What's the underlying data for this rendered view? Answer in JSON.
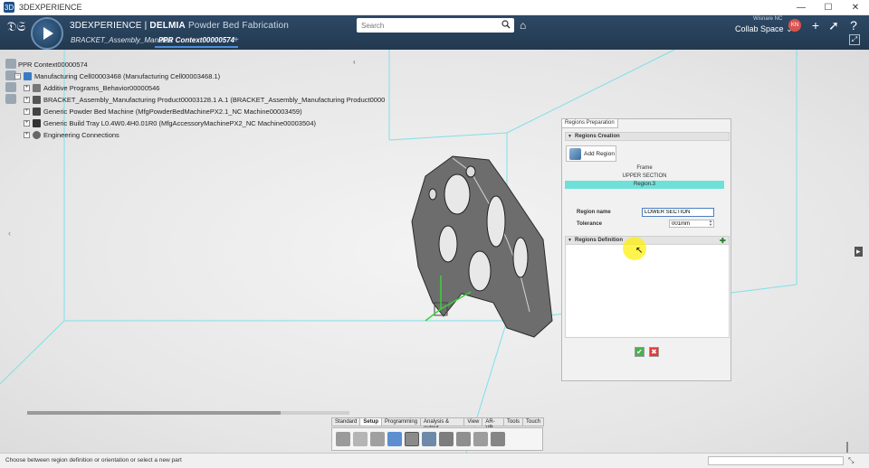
{
  "window": {
    "title": "3DEXPERIENCE",
    "controls": [
      "—",
      "☐",
      "✕"
    ]
  },
  "appbar": {
    "brand": "3DEXPERIENCE",
    "separator": " | ",
    "product": "DELMIA",
    "app": "Powder Bed Fabrication",
    "search_placeholder": "Search",
    "user_name": "Wisnare NC",
    "avatar_initials": "KN",
    "collab_space": "Collab Space"
  },
  "tabs": [
    {
      "label": "BRACKET_Assembly_Manufac",
      "active": false
    },
    {
      "label": "PPR Context00000574",
      "active": true
    }
  ],
  "tree": {
    "root": "PPR Context00000574",
    "items": [
      {
        "label": "Manufacturing Cell00003468 (Manufacturing Cell00003468.1)",
        "level": 1,
        "expander": "−",
        "icon": "manufacturing-cell-icon",
        "color": "#3a7cc4"
      },
      {
        "label": "Additive Programs_Behavior00000546",
        "level": 2,
        "expander": "+",
        "icon": "program-icon",
        "color": "#777777"
      },
      {
        "label": "BRACKET_Assembly_Manufacturing Product00003128.1 A.1 (BRACKET_Assembly_Manufacturing Product0000",
        "level": 2,
        "expander": "+",
        "icon": "product-icon",
        "color": "#555555"
      },
      {
        "label": "Generic Powder Bed Machine (MfgPowderBedMachinePX2.1_NC Machine00003459)",
        "level": 2,
        "expander": "+",
        "icon": "machine-icon",
        "color": "#444444"
      },
      {
        "label": "Generic Build Tray L0.4W0.4H0.01R0 (MfgAccessoryMachinePX2_NC Machine00003504)",
        "level": 2,
        "expander": "+",
        "icon": "tray-icon",
        "color": "#333333"
      },
      {
        "label": "Engineering Connections",
        "level": 2,
        "expander": "+",
        "icon": "connections-icon",
        "color": "#666666"
      }
    ]
  },
  "panel": {
    "tab_label": "Regions Preparation",
    "creation_header": "Regions Creation",
    "add_region_label": "Add Region",
    "regions": [
      {
        "label": "Frame",
        "selected": false
      },
      {
        "label": "UPPER SECTION",
        "selected": false
      },
      {
        "label": "Region.3",
        "selected": true
      }
    ],
    "region_name_label": "Region name",
    "region_name_value": "LOWER SECTION",
    "tolerance_label": "Tolerance",
    "tolerance_value": "001mm",
    "definition_header": "Regions Definition",
    "ok_label": "✔",
    "cancel_label": "✖"
  },
  "action_bar": {
    "tabs": [
      {
        "label": "Standard",
        "active": false
      },
      {
        "label": "Setup",
        "active": true
      },
      {
        "label": "Programming",
        "active": false
      },
      {
        "label": "Analysis & output",
        "active": false
      },
      {
        "label": "View",
        "active": false
      },
      {
        "label": "AR-VR",
        "active": false
      },
      {
        "label": "Tools",
        "active": false
      },
      {
        "label": "Touch",
        "active": false
      }
    ]
  },
  "status": {
    "message": "Choose between region definition or orientation or select a new part"
  },
  "colors": {
    "accent": "#4a90d9",
    "selection": "#6fe0d8",
    "grid_lines": "#7ee0e8",
    "appbar": "#2b4560"
  }
}
